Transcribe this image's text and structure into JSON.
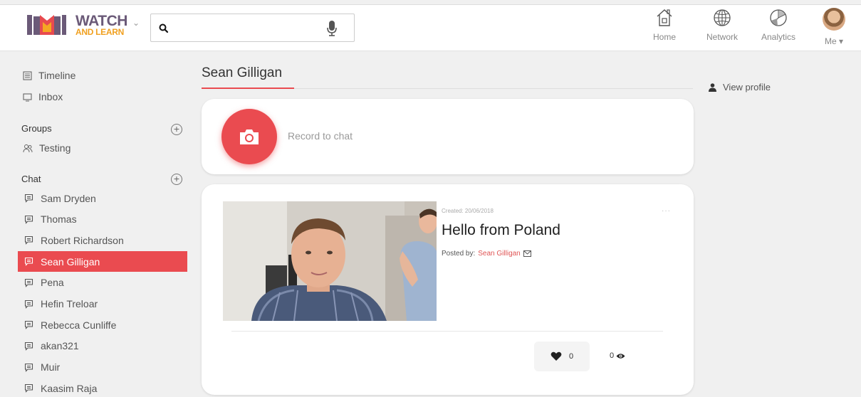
{
  "brand": {
    "line1": "WATCH",
    "line2": "AND LEARN"
  },
  "search": {
    "value": "",
    "placeholder": ""
  },
  "nav": {
    "home": "Home",
    "network": "Network",
    "analytics": "Analytics",
    "me": "Me ▾"
  },
  "sidebar": {
    "timeline": "Timeline",
    "inbox": "Inbox",
    "groups_heading": "Groups",
    "groups": [
      "Testing"
    ],
    "chat_heading": "Chat",
    "chats": [
      "Sam Dryden",
      "Thomas",
      "Robert Richardson",
      "Sean Gilligan",
      "Pena",
      "Hefin Treloar",
      "Rebecca Cunliffe",
      "akan321",
      "Muir",
      "Kaasim Raja"
    ],
    "active_chat": "Sean Gilligan"
  },
  "page": {
    "title": "Sean Gilligan"
  },
  "record": {
    "label": "Record to chat"
  },
  "post": {
    "created": "Created: 20/06/2018",
    "more": "···",
    "title": "Hello from Poland",
    "posted_by_label": "Posted by:",
    "author": "Sean Gilligan",
    "likes": "0",
    "views": "0"
  },
  "profile": {
    "view_label": "View profile"
  },
  "colors": {
    "accent": "#ea4b50",
    "brand_purple": "#6b5a78",
    "brand_orange": "#f0a020"
  }
}
